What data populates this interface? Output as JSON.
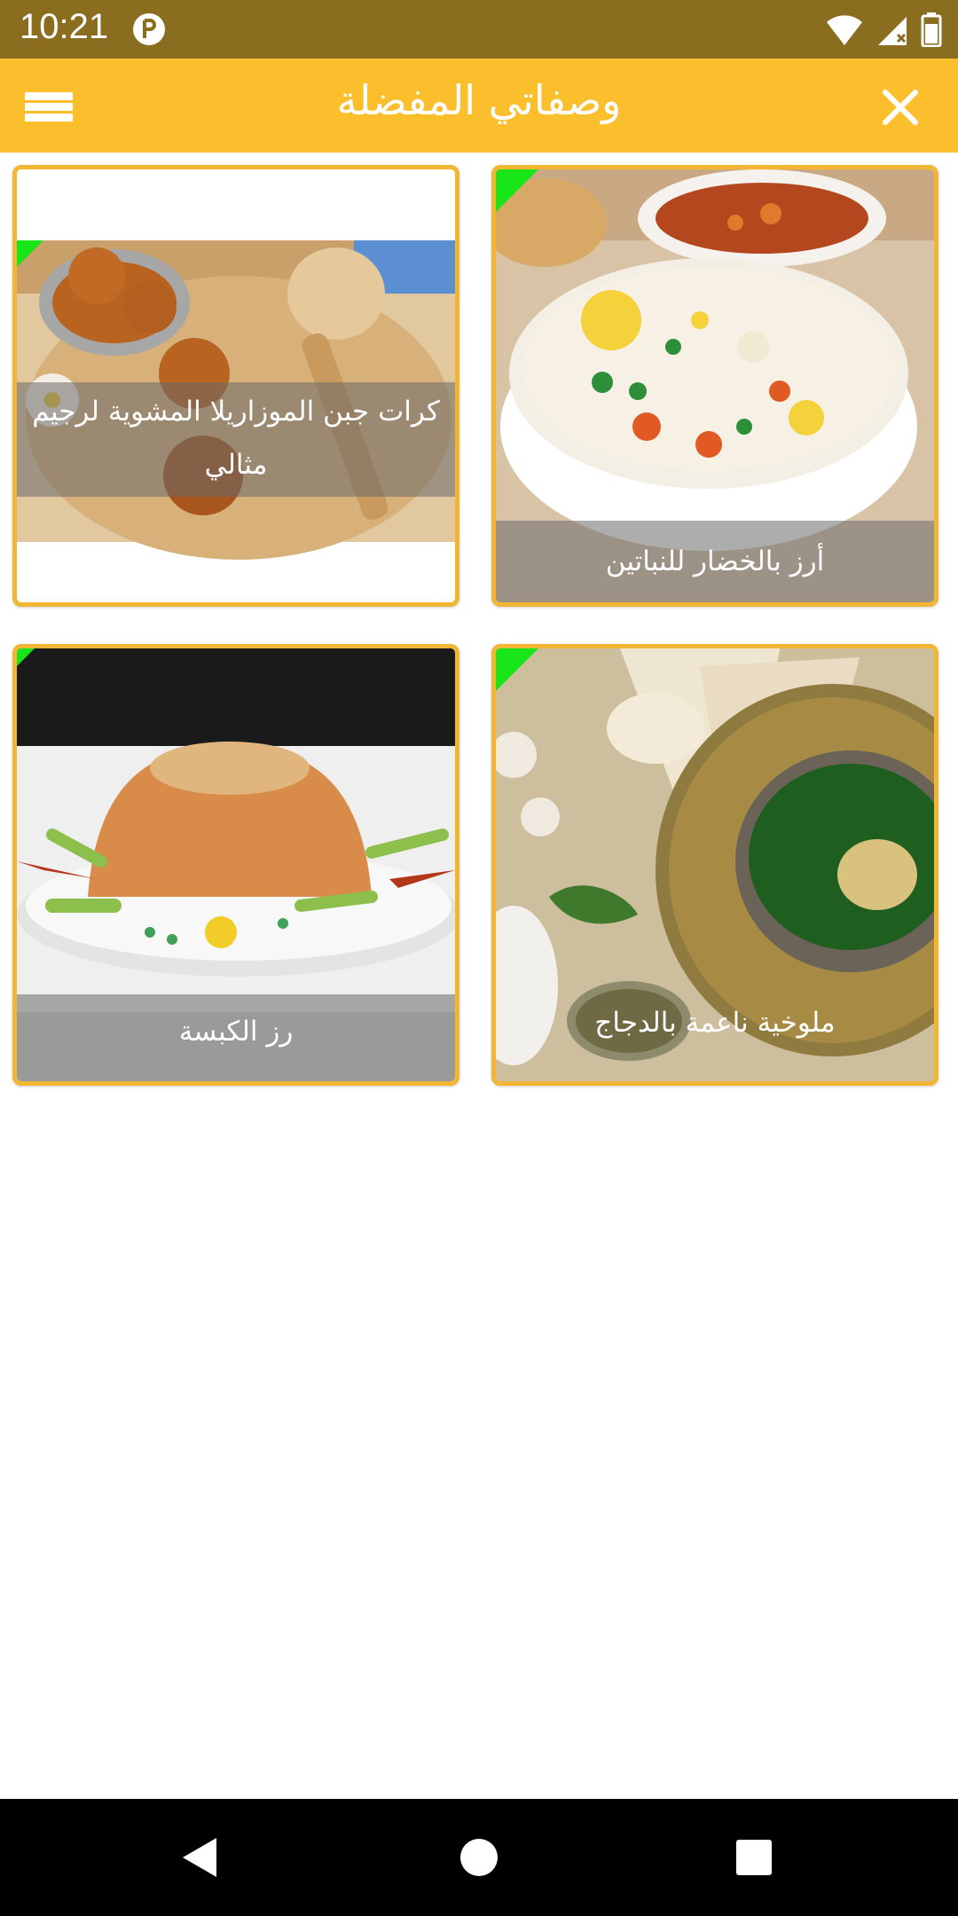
{
  "status_bar": {
    "time": "10:21",
    "icons": [
      "app-notification-icon",
      "wifi-icon",
      "signal-icon",
      "battery-icon"
    ]
  },
  "app_bar": {
    "title": "وصفاتي المفضلة",
    "menu_icon": "hamburger-menu-icon",
    "close_icon": "close-icon",
    "background_color": "#fbbf2e"
  },
  "recipes": [
    {
      "title": "أرز بالخضار للنباتين",
      "image": "vegetable-rice-photo"
    },
    {
      "title": "كرات جبن الموزاريلا المشوية لرجيم مثالي",
      "image": "mozzarella-balls-photo"
    },
    {
      "title": "ملوخية ناعمة بالدجاج",
      "image": "molokhia-photo"
    },
    {
      "title": "رز الكبسة",
      "image": "kabsa-rice-photo"
    }
  ],
  "nav_bar": {
    "icons": [
      "back-icon",
      "home-icon",
      "recents-icon"
    ]
  },
  "colors": {
    "status_bar": "#8a6d1e",
    "card_border": "#f2b632",
    "corner_tag": "#19e619"
  }
}
